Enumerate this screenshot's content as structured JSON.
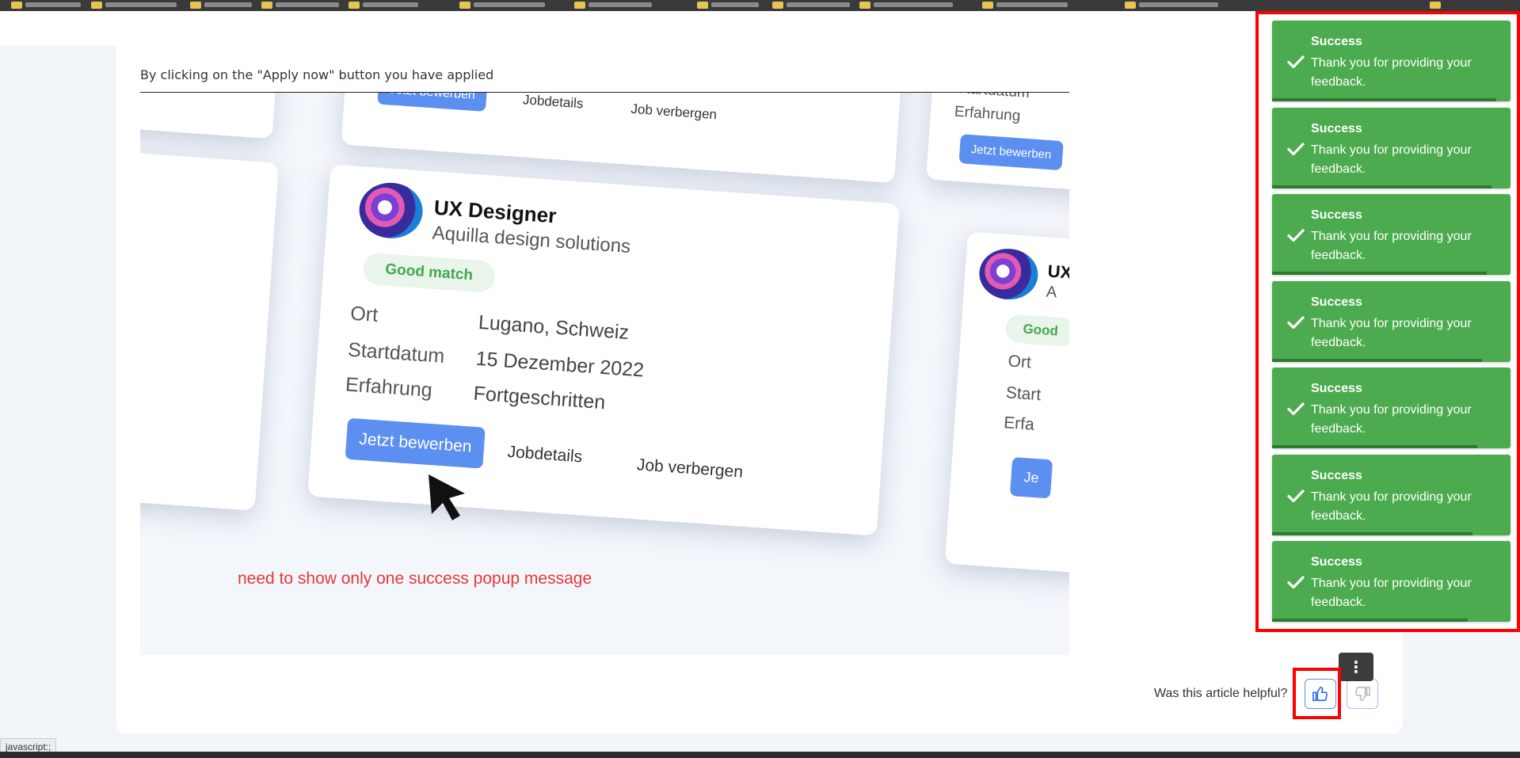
{
  "article": {
    "intro": "By clicking on the \"Apply now\" button you have applied",
    "annotation": "need to show only one success popup message"
  },
  "figure": {
    "main_card": {
      "title": "UX Designer",
      "company": "Aquilla design solutions",
      "match": "Good match",
      "labels": [
        "Ort",
        "Startdatum",
        "Erfahrung"
      ],
      "values": [
        "Lugano, Schweiz",
        "15 Dezember 2022",
        "Fortgeschritten"
      ],
      "apply": "Jetzt bewerben",
      "details": "Jobdetails",
      "hide": "Job verbergen"
    },
    "top_card": {
      "apply": "Jetzt bewerben",
      "details": "Jobdetails",
      "hide": "Job verbergen"
    },
    "right_top_card": {
      "labels": [
        "Startdatum",
        "Erfahrung"
      ],
      "apply": "Jetzt bewerben"
    },
    "right_card": {
      "title_fragment": "UX",
      "company_fragment": "A",
      "match_fragment": "Good",
      "labels": [
        "Ort",
        "Start",
        "Erfa"
      ],
      "apply_fragment": "Je"
    }
  },
  "feedback": {
    "question": "Was this article helpful?",
    "like_icon": "thumbs-up-icon",
    "dislike_icon": "thumbs-down-icon",
    "more_icon": "more-vertical-icon"
  },
  "toasts": [
    {
      "title": "Success",
      "message": "Thank you for providing your feedback.",
      "progress": 0.94
    },
    {
      "title": "Success",
      "message": "Thank you for providing your feedback.",
      "progress": 0.92
    },
    {
      "title": "Success",
      "message": "Thank you for providing your feedback.",
      "progress": 0.9
    },
    {
      "title": "Success",
      "message": "Thank you for providing your feedback.",
      "progress": 0.88
    },
    {
      "title": "Success",
      "message": "Thank you for providing your feedback.",
      "progress": 0.86
    },
    {
      "title": "Success",
      "message": "Thank you for providing your feedback.",
      "progress": 0.84
    },
    {
      "title": "Success",
      "message": "Thank you for providing your feedback.",
      "progress": 0.82
    }
  ],
  "status_bar": {
    "link_preview": "javascript:;"
  },
  "colors": {
    "toast_bg": "#4caa4f",
    "accent": "#5b8ff0",
    "annotation": "#ff0000"
  }
}
